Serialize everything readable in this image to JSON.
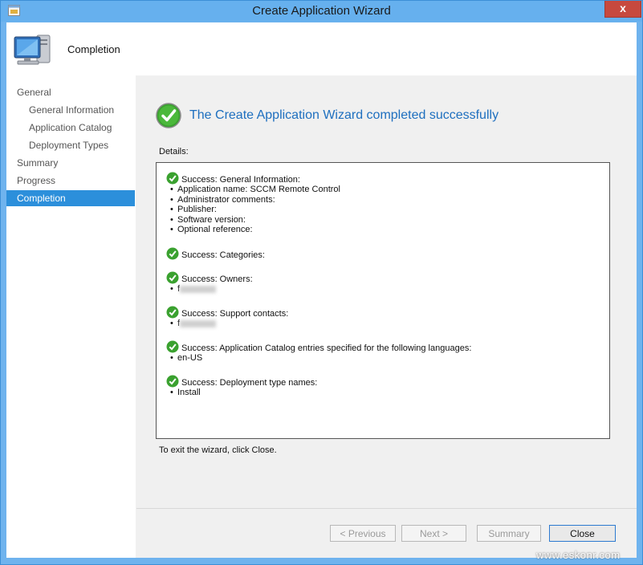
{
  "window": {
    "title": "Create Application Wizard",
    "close_glyph": "x"
  },
  "header": {
    "title": "Completion",
    "icon": "computer-icon"
  },
  "nav": {
    "items": [
      {
        "label": "General",
        "level": "top"
      },
      {
        "label": "General Information",
        "level": "sub"
      },
      {
        "label": "Application Catalog",
        "level": "sub"
      },
      {
        "label": "Deployment Types",
        "level": "sub"
      },
      {
        "label": "Summary",
        "level": "top"
      },
      {
        "label": "Progress",
        "level": "top"
      },
      {
        "label": "Completion",
        "level": "top",
        "active": true
      }
    ]
  },
  "main": {
    "heading": "The Create Application Wizard completed successfully",
    "details_label": "Details:",
    "details": [
      {
        "header": "Success: General Information:",
        "items": [
          "Application name: SCCM Remote Control",
          "Administrator comments:",
          "Publisher:",
          "Software version:",
          "Optional reference:"
        ]
      },
      {
        "header": "Success: Categories:",
        "items": []
      },
      {
        "header": "Success: Owners:",
        "items": [
          "f"
        ]
      },
      {
        "header": "Success: Support contacts:",
        "items": [
          "f"
        ]
      },
      {
        "header": "Success: Application Catalog entries specified for the following languages:",
        "items": [
          "en-US"
        ]
      },
      {
        "header": "Success: Deployment type names:",
        "items": [
          "Install"
        ]
      }
    ],
    "exit_text": "To exit the wizard, click Close."
  },
  "buttons": {
    "previous": "< Previous",
    "next": "Next >",
    "summary": "Summary",
    "close": "Close"
  },
  "watermark": "www.eskonr.com",
  "colors": {
    "accent": "#2c8fdb",
    "heading": "#1e6fbf",
    "titlebar": "#66b0ee",
    "success": "#3aa12f"
  }
}
